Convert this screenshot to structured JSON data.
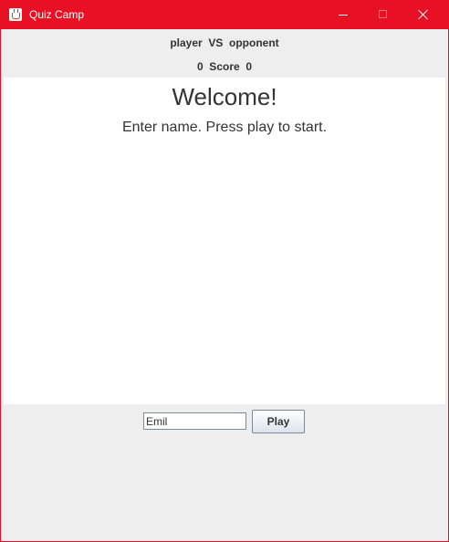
{
  "window": {
    "title": "Quiz Camp",
    "accent_color": "#e81123",
    "icon": "java-cup-icon"
  },
  "controls": {
    "minimize_icon": "minimize-icon",
    "maximize_icon": "maximize-icon",
    "close_icon": "close-icon"
  },
  "header": {
    "players_line": "player  VS  opponent",
    "score_line": "0  Score  0"
  },
  "main": {
    "welcome": "Welcome!",
    "instruction": "Enter name. Press play to start."
  },
  "footer": {
    "name_value": "Emil",
    "play_label": "Play"
  }
}
